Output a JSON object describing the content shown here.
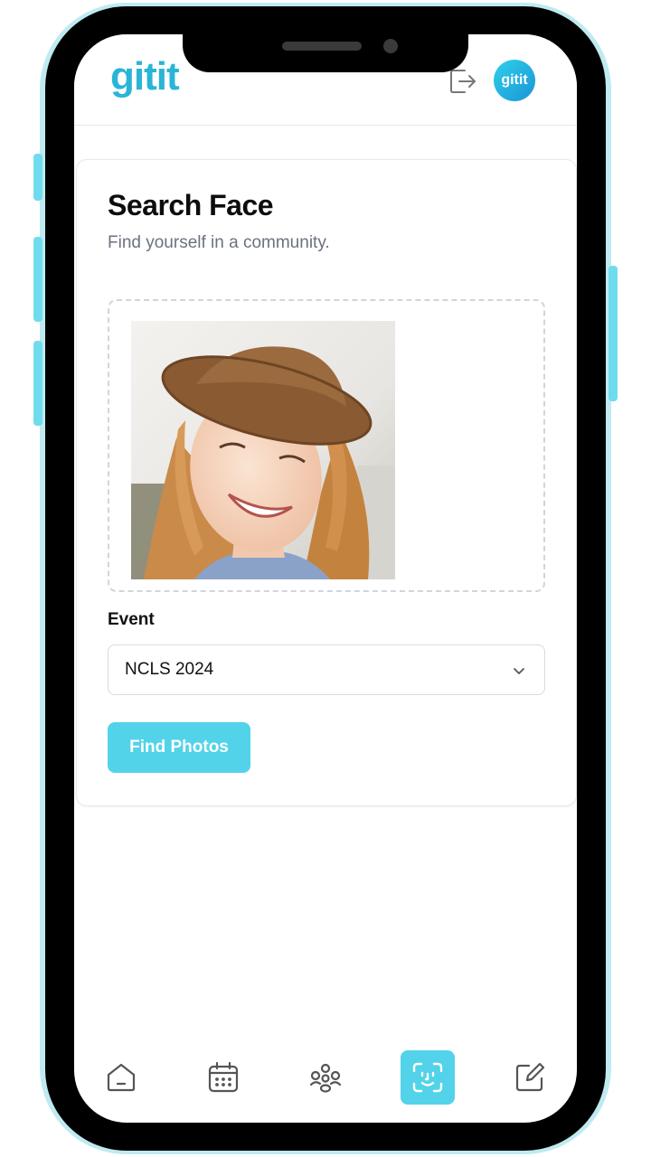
{
  "header": {
    "logo_text": "gitit",
    "avatar_text": "gitit",
    "logout_icon": "logout-icon"
  },
  "search_face": {
    "title": "Search Face",
    "subtitle": "Find yourself in a community.",
    "uploaded_photo_alt": "photo of smiling woman in a brown hat",
    "event_label": "Event",
    "event_selected": "NCLS 2024",
    "find_button_label": "Find Photos"
  },
  "bottom_nav": {
    "items": [
      {
        "icon": "home-icon",
        "active": false
      },
      {
        "icon": "calendar-icon",
        "active": false
      },
      {
        "icon": "community-icon",
        "active": false
      },
      {
        "icon": "face-scan-icon",
        "active": true
      },
      {
        "icon": "edit-icon",
        "active": false
      }
    ]
  },
  "colors": {
    "accent": "#52d3ea",
    "logo": "#2ab5d6",
    "text_muted": "#6b7280"
  }
}
